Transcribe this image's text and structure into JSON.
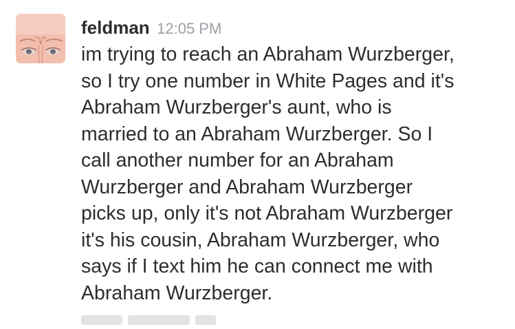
{
  "message": {
    "author": "feldman",
    "timestamp": "12:05 PM",
    "avatar_icon": "user-avatar-photo",
    "lines": [
      "im trying to reach an Abraham Wurzberger,",
      "so I try one number in White Pages and it's",
      "Abraham Wurzberger's aunt, who is",
      "married to an Abraham Wurzberger. So I",
      "call another number for an Abraham",
      "Wurzberger and Abraham Wurzberger",
      "picks up, only it's not Abraham Wurzberger",
      "it's his cousin, Abraham Wurzberger, who",
      "says if I text him he can connect me with",
      "Abraham Wurzberger."
    ]
  },
  "colors": {
    "text": "#2c2d30",
    "timestamp": "#9e9ea6",
    "avatar_skin": "#f4c4b4"
  }
}
